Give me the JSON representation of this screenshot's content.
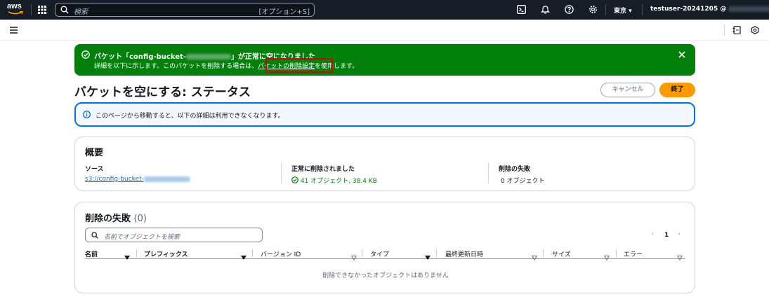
{
  "topbar": {
    "logo_text": "aws",
    "search_placeholder": "検索",
    "search_shortcut": "[オプション+S]",
    "region": "東京",
    "account_label": "testuser-20241205 @",
    "icons": [
      "grid-icon",
      "search-icon",
      "cloudshell-icon",
      "bell-icon",
      "help-icon",
      "gear-icon",
      "caret-down-icon"
    ]
  },
  "flash": {
    "title_prefix": "バケット「config-bucket-",
    "title_suffix": "」が正常に空になりました",
    "body_prefix": "詳細を以下に示します。このバケットを削除する場合は、",
    "body_link": "バケットの削除設定",
    "body_suffix": "を使用します。",
    "color": "#037f0c"
  },
  "page": {
    "title": "バケットを空にする: ステータス",
    "cancel_label": "キャンセル",
    "done_label": "終了"
  },
  "info": {
    "text": "このページから移動すると、以下の詳細は利用できなくなります。"
  },
  "summary": {
    "title": "概要",
    "source_label": "ソース",
    "source_value": "s3://config-bucket-",
    "success_label": "正常に削除されました",
    "success_value": "41 オブジェクト, 38.4 KB",
    "failed_label": "削除の失敗",
    "failed_value": "0 オブジェクト"
  },
  "failures": {
    "title": "削除の失敗",
    "count": "(0)",
    "search_placeholder": "名前でオブジェクトを検索",
    "page": "1",
    "columns": [
      "名前",
      "プレフィックス",
      "バージョン ID",
      "タイプ",
      "最終更新日時",
      "サイズ",
      "エラー"
    ],
    "empty_text": "削除できなかったオブジェクトはありません"
  },
  "colors": {
    "accent": "#ff9900",
    "link": "#0972d3",
    "success": "#037f0c",
    "topbar": "#161d26"
  }
}
